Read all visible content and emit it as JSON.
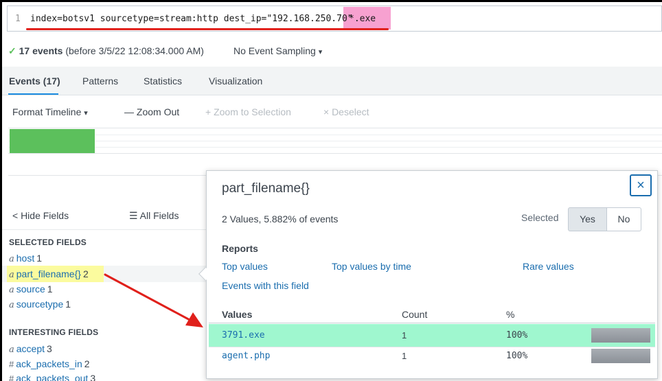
{
  "search": {
    "line_number": "1",
    "query_main": "index=botsv1 sourcetype=stream:http dest_ip=\"192.168.250.70\"",
    "query_highlight": "*.exe"
  },
  "status": {
    "check": "✓",
    "events_count": "17 events",
    "events_detail": "(before 3/5/22 12:08:34.000 AM)",
    "sampling": "No Event Sampling",
    "sampling_caret": "▾"
  },
  "tabs": [
    "Events (17)",
    "Patterns",
    "Statistics",
    "Visualization"
  ],
  "timeline": {
    "format": "Format Timeline",
    "format_caret": "▾",
    "zoom_out": "— Zoom Out",
    "zoom_selection": "+ Zoom to Selection",
    "deselect": "× Deselect",
    "bar_fraction": 0.13
  },
  "sidebar": {
    "hide_fields": "< Hide Fields",
    "all_fields": "☰ All Fields",
    "selected_heading": "SELECTED FIELDS",
    "selected_fields": [
      {
        "type": "a",
        "name": "host",
        "count": "1"
      },
      {
        "type": "a",
        "name": "part_filename{}",
        "count": "2"
      },
      {
        "type": "a",
        "name": "source",
        "count": "1"
      },
      {
        "type": "a",
        "name": "sourcetype",
        "count": "1"
      }
    ],
    "interesting_heading": "INTERESTING FIELDS",
    "interesting_fields": [
      {
        "type": "a",
        "name": "accept",
        "count": "3"
      },
      {
        "type": "#",
        "name": "ack_packets_in",
        "count": "2"
      },
      {
        "type": "#",
        "name": "ack_packets_out",
        "count": "3"
      }
    ]
  },
  "popover": {
    "title": "part_filename{}",
    "close": "×",
    "summary": "2 Values, 5.882% of events",
    "selected_label": "Selected",
    "yes": "Yes",
    "no": "No",
    "reports_heading": "Reports",
    "reports": [
      "Top values",
      "Top values by time",
      "Rare values",
      "Events with this field"
    ],
    "columns": [
      "Values",
      "Count",
      "%"
    ],
    "rows": [
      {
        "value": "3791.exe",
        "count": "1",
        "percent": "100%",
        "fraction": 1.0
      },
      {
        "value": "agent.php",
        "count": "1",
        "percent": "100%",
        "fraction": 1.0
      }
    ]
  },
  "colors": {
    "accent": "#1a8be0",
    "link": "#1a6dae",
    "timeline_bar": "#5cc05c",
    "query_highlight": "#f7a1d0",
    "row_highlight": "#9ff7cf",
    "field_highlight": "#fbfb9e",
    "annotation_red": "#e0201b"
  }
}
